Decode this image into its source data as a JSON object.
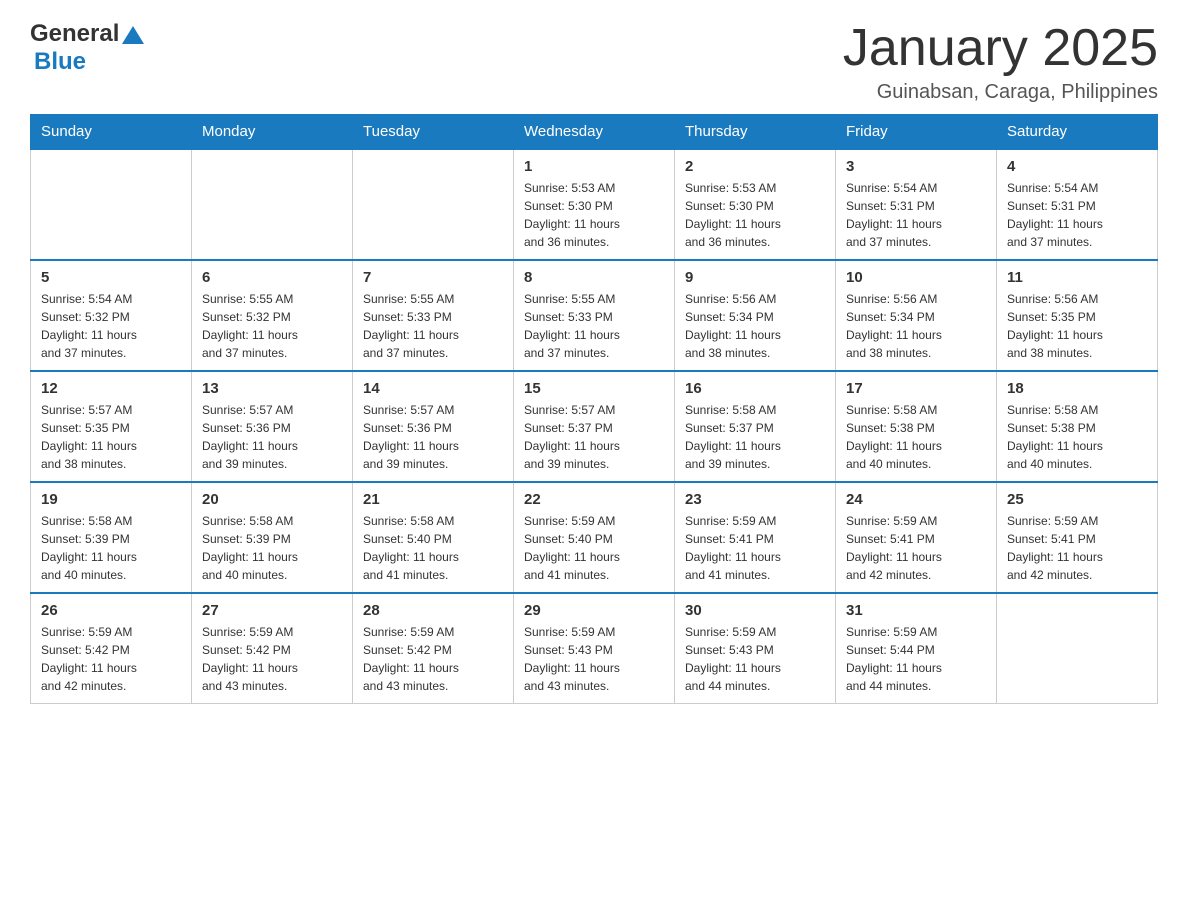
{
  "logo": {
    "general_text": "General",
    "blue_text": "Blue"
  },
  "title": "January 2025",
  "location": "Guinabsan, Caraga, Philippines",
  "days_of_week": [
    "Sunday",
    "Monday",
    "Tuesday",
    "Wednesday",
    "Thursday",
    "Friday",
    "Saturday"
  ],
  "weeks": [
    {
      "cells": [
        {
          "day": "",
          "info": ""
        },
        {
          "day": "",
          "info": ""
        },
        {
          "day": "",
          "info": ""
        },
        {
          "day": "1",
          "info": "Sunrise: 5:53 AM\nSunset: 5:30 PM\nDaylight: 11 hours\nand 36 minutes."
        },
        {
          "day": "2",
          "info": "Sunrise: 5:53 AM\nSunset: 5:30 PM\nDaylight: 11 hours\nand 36 minutes."
        },
        {
          "day": "3",
          "info": "Sunrise: 5:54 AM\nSunset: 5:31 PM\nDaylight: 11 hours\nand 37 minutes."
        },
        {
          "day": "4",
          "info": "Sunrise: 5:54 AM\nSunset: 5:31 PM\nDaylight: 11 hours\nand 37 minutes."
        }
      ]
    },
    {
      "cells": [
        {
          "day": "5",
          "info": "Sunrise: 5:54 AM\nSunset: 5:32 PM\nDaylight: 11 hours\nand 37 minutes."
        },
        {
          "day": "6",
          "info": "Sunrise: 5:55 AM\nSunset: 5:32 PM\nDaylight: 11 hours\nand 37 minutes."
        },
        {
          "day": "7",
          "info": "Sunrise: 5:55 AM\nSunset: 5:33 PM\nDaylight: 11 hours\nand 37 minutes."
        },
        {
          "day": "8",
          "info": "Sunrise: 5:55 AM\nSunset: 5:33 PM\nDaylight: 11 hours\nand 37 minutes."
        },
        {
          "day": "9",
          "info": "Sunrise: 5:56 AM\nSunset: 5:34 PM\nDaylight: 11 hours\nand 38 minutes."
        },
        {
          "day": "10",
          "info": "Sunrise: 5:56 AM\nSunset: 5:34 PM\nDaylight: 11 hours\nand 38 minutes."
        },
        {
          "day": "11",
          "info": "Sunrise: 5:56 AM\nSunset: 5:35 PM\nDaylight: 11 hours\nand 38 minutes."
        }
      ]
    },
    {
      "cells": [
        {
          "day": "12",
          "info": "Sunrise: 5:57 AM\nSunset: 5:35 PM\nDaylight: 11 hours\nand 38 minutes."
        },
        {
          "day": "13",
          "info": "Sunrise: 5:57 AM\nSunset: 5:36 PM\nDaylight: 11 hours\nand 39 minutes."
        },
        {
          "day": "14",
          "info": "Sunrise: 5:57 AM\nSunset: 5:36 PM\nDaylight: 11 hours\nand 39 minutes."
        },
        {
          "day": "15",
          "info": "Sunrise: 5:57 AM\nSunset: 5:37 PM\nDaylight: 11 hours\nand 39 minutes."
        },
        {
          "day": "16",
          "info": "Sunrise: 5:58 AM\nSunset: 5:37 PM\nDaylight: 11 hours\nand 39 minutes."
        },
        {
          "day": "17",
          "info": "Sunrise: 5:58 AM\nSunset: 5:38 PM\nDaylight: 11 hours\nand 40 minutes."
        },
        {
          "day": "18",
          "info": "Sunrise: 5:58 AM\nSunset: 5:38 PM\nDaylight: 11 hours\nand 40 minutes."
        }
      ]
    },
    {
      "cells": [
        {
          "day": "19",
          "info": "Sunrise: 5:58 AM\nSunset: 5:39 PM\nDaylight: 11 hours\nand 40 minutes."
        },
        {
          "day": "20",
          "info": "Sunrise: 5:58 AM\nSunset: 5:39 PM\nDaylight: 11 hours\nand 40 minutes."
        },
        {
          "day": "21",
          "info": "Sunrise: 5:58 AM\nSunset: 5:40 PM\nDaylight: 11 hours\nand 41 minutes."
        },
        {
          "day": "22",
          "info": "Sunrise: 5:59 AM\nSunset: 5:40 PM\nDaylight: 11 hours\nand 41 minutes."
        },
        {
          "day": "23",
          "info": "Sunrise: 5:59 AM\nSunset: 5:41 PM\nDaylight: 11 hours\nand 41 minutes."
        },
        {
          "day": "24",
          "info": "Sunrise: 5:59 AM\nSunset: 5:41 PM\nDaylight: 11 hours\nand 42 minutes."
        },
        {
          "day": "25",
          "info": "Sunrise: 5:59 AM\nSunset: 5:41 PM\nDaylight: 11 hours\nand 42 minutes."
        }
      ]
    },
    {
      "cells": [
        {
          "day": "26",
          "info": "Sunrise: 5:59 AM\nSunset: 5:42 PM\nDaylight: 11 hours\nand 42 minutes."
        },
        {
          "day": "27",
          "info": "Sunrise: 5:59 AM\nSunset: 5:42 PM\nDaylight: 11 hours\nand 43 minutes."
        },
        {
          "day": "28",
          "info": "Sunrise: 5:59 AM\nSunset: 5:42 PM\nDaylight: 11 hours\nand 43 minutes."
        },
        {
          "day": "29",
          "info": "Sunrise: 5:59 AM\nSunset: 5:43 PM\nDaylight: 11 hours\nand 43 minutes."
        },
        {
          "day": "30",
          "info": "Sunrise: 5:59 AM\nSunset: 5:43 PM\nDaylight: 11 hours\nand 44 minutes."
        },
        {
          "day": "31",
          "info": "Sunrise: 5:59 AM\nSunset: 5:44 PM\nDaylight: 11 hours\nand 44 minutes."
        },
        {
          "day": "",
          "info": ""
        }
      ]
    }
  ]
}
